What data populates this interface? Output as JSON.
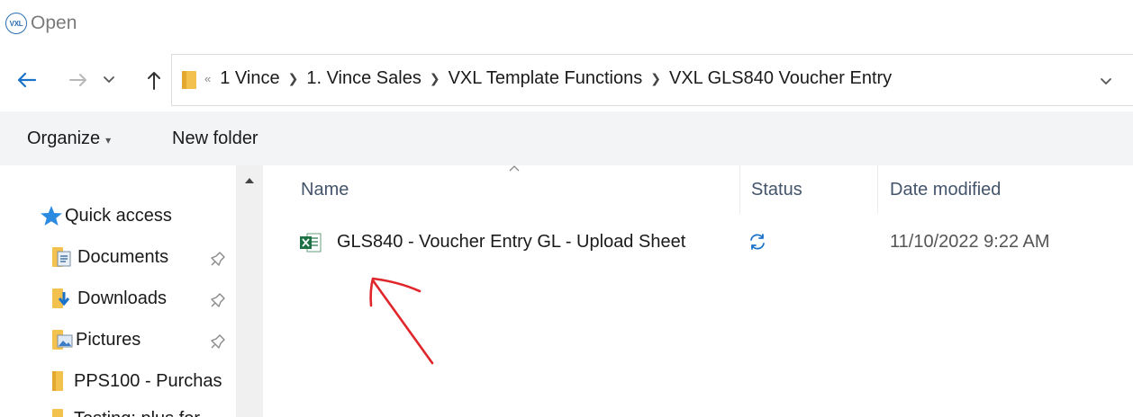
{
  "window": {
    "title": "Open",
    "app_logo_text": "VXL"
  },
  "address": {
    "overflow_chevron": "«",
    "crumbs": [
      "1 Vince",
      "1. Vince Sales",
      "VXL Template Functions",
      "VXL GLS840 Voucher Entry"
    ]
  },
  "toolbar": {
    "organize_label": "Organize",
    "new_folder_label": "New folder"
  },
  "nav": {
    "quick_access": "Quick access",
    "items": [
      "Documents",
      "Downloads",
      "Pictures",
      "PPS100 - Purchas",
      "Testing: plus for"
    ]
  },
  "columns": {
    "name": "Name",
    "status": "Status",
    "date_modified": "Date modified"
  },
  "files": [
    {
      "name": "GLS840 - Voucher Entry GL - Upload Sheet",
      "status_icon": "sync-icon",
      "date_modified": "11/10/2022 9:22 AM",
      "type_icon": "excel-icon"
    }
  ],
  "colors": {
    "accent": "#1a73c9",
    "folder": "#f2c14e",
    "excel": "#1e7145",
    "annotation": "#e0262b"
  }
}
